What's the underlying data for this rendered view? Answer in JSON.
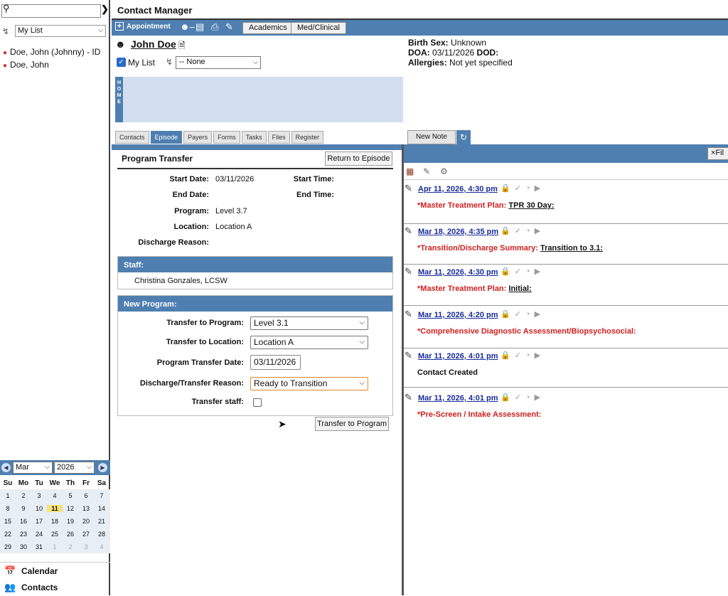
{
  "sidebar": {
    "list_select": "My List",
    "contacts": [
      "Doe, John (Johnny) - ID",
      "Doe, John"
    ],
    "calendar": {
      "month": "Mar",
      "year": "2026",
      "weekdays": [
        "Su",
        "Mo",
        "Tu",
        "We",
        "Th",
        "Fr",
        "Sa"
      ],
      "weeks": [
        [
          "1",
          "2",
          "3",
          "4",
          "5",
          "6",
          "7"
        ],
        [
          "8",
          "9",
          "10",
          "11",
          "12",
          "13",
          "14"
        ],
        [
          "15",
          "16",
          "17",
          "18",
          "19",
          "20",
          "21"
        ],
        [
          "22",
          "23",
          "24",
          "25",
          "26",
          "27",
          "28"
        ],
        [
          "29",
          "30",
          "31",
          "1",
          "2",
          "3",
          "4"
        ]
      ]
    },
    "nav_calendar": "Calendar",
    "nav_contacts": "Contacts"
  },
  "header": {
    "title": "Contact Manager",
    "appointment": "Appointment",
    "academics": "Academics",
    "medclinical": "Med/Clinical"
  },
  "patient": {
    "name": "John Doe",
    "mylist_label": "My List",
    "tag_select": "-- None",
    "home_label": "HOME",
    "birth_sex_label": "Birth Sex:",
    "birth_sex": "Unknown",
    "doa_label": "DOA:",
    "doa": "03/11/2026",
    "dod_label": "DOD:",
    "allergies_label": "Allergies:",
    "allergies": "Not yet specified"
  },
  "tabs": [
    "Contacts",
    "Episode",
    "Payers",
    "Forms",
    "Tasks",
    "Files",
    "Register"
  ],
  "form": {
    "title": "Program Transfer",
    "return_button": "Return to Episode",
    "start_date_label": "Start Date:",
    "start_date": "03/11/2026",
    "start_time_label": "Start Time:",
    "end_date_label": "End Date:",
    "end_time_label": "End Time:",
    "program_label": "Program:",
    "program": "Level 3.7",
    "location_label": "Location:",
    "location": "Location A",
    "discharge_label": "Discharge Reason:",
    "staff_header": "Staff:",
    "staff": "Christina Gonzales, LCSW",
    "new_program_header": "New Program:",
    "transfer_program_label": "Transfer to Program:",
    "transfer_program": "Level 3.1",
    "transfer_location_label": "Transfer to Location:",
    "transfer_location": "Location A",
    "transfer_date_label": "Program Transfer Date:",
    "transfer_date": "03/11/2026",
    "reason_label": "Discharge/Transfer Reason:",
    "reason": "Ready to Transition",
    "transfer_staff_label": "Transfer staff:",
    "transfer_button": "Transfer to Program"
  },
  "notes_panel": {
    "new_note": "New Note",
    "filter": "Fil",
    "notes": [
      {
        "date": "Apr 11, 2026, 4:30 pm",
        "type": "*Master Treatment Plan:",
        "detail": "TPR 30 Day:"
      },
      {
        "date": "Mar 18, 2026, 4:35 pm",
        "type": "*Transition/Discharge Summary:",
        "detail": "Transition to 3.1:"
      },
      {
        "date": "Mar 11, 2026, 4:30 pm",
        "type": "*Master Treatment Plan:",
        "detail": "Initial:"
      },
      {
        "date": "Mar 11, 2026, 4:20 pm",
        "type": "*Comprehensive Diagnostic Assessment/Biopsychosocial:",
        "detail": ""
      },
      {
        "date": "Mar 11, 2026, 4:01 pm",
        "type": "Contact Created",
        "detail": ""
      },
      {
        "date": "Mar 11, 2026, 4:01 pm",
        "type": "*Pre-Screen / Intake Assessment:",
        "detail": ""
      }
    ]
  },
  "colors": {
    "accent": "#4e7fb0",
    "link": "#1a2b9b",
    "alert": "#d02020",
    "today": "#f6e27a"
  }
}
